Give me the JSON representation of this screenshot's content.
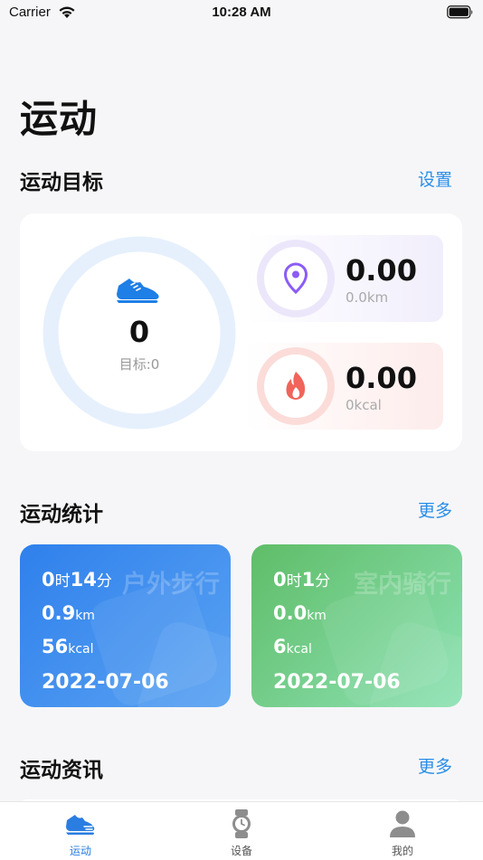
{
  "status_bar": {
    "carrier": "Carrier",
    "time": "10:28 AM"
  },
  "page": {
    "title": "运动"
  },
  "goal_section": {
    "title": "运动目标",
    "action_label": "设置",
    "steps": "0",
    "steps_target": "目标:0",
    "distance": {
      "value": "0.00",
      "unit_text": "0.0km"
    },
    "calories": {
      "value": "0.00",
      "unit_text": "0kcal"
    }
  },
  "stats_section": {
    "title": "运动统计",
    "action_label": "更多",
    "cards": [
      {
        "type": "户外步行",
        "hours": "0",
        "hours_unit": "时",
        "minutes": "14",
        "minutes_unit": "分",
        "distance": "0.9",
        "distance_unit": "km",
        "calories": "56",
        "calories_unit": "kcal",
        "date": "2022-07-06"
      },
      {
        "type": "室内骑行",
        "hours": "0",
        "hours_unit": "时",
        "minutes": "1",
        "minutes_unit": "分",
        "distance": "0.0",
        "distance_unit": "km",
        "calories": "6",
        "calories_unit": "kcal",
        "date": "2022-07-06"
      }
    ]
  },
  "news_section": {
    "title": "运动资讯",
    "action_label": "更多"
  },
  "tabs": [
    {
      "label": "运动",
      "icon": "running-shoe-icon",
      "active": true
    },
    {
      "label": "设备",
      "icon": "watch-icon",
      "active": false
    },
    {
      "label": "我的",
      "icon": "person-icon",
      "active": false
    }
  ],
  "colors": {
    "accent": "#2a8ee8",
    "walk_card": "#2f80ec",
    "ride_card": "#5fbd68",
    "distance_icon": "#8b5cf6",
    "calorie_icon": "#f0645a"
  }
}
